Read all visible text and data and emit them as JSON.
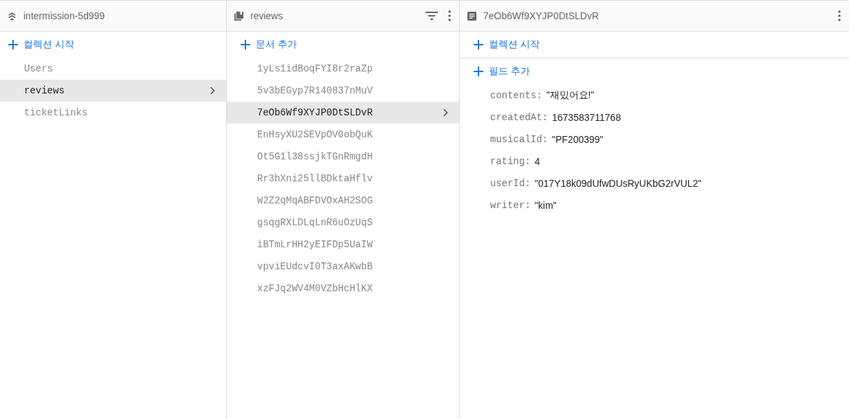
{
  "panels": [
    {
      "title": "intermission-5d999",
      "actions": [
        "컬렉션 시작"
      ],
      "items": [
        {
          "label": "Users",
          "selected": false
        },
        {
          "label": "reviews",
          "selected": true
        },
        {
          "label": "ticketLinks",
          "selected": false
        }
      ]
    },
    {
      "title": "reviews",
      "actions": [
        "문서 추가"
      ],
      "items": [
        {
          "label": "1yLs1idBoqFYI8r2raZp",
          "selected": false
        },
        {
          "label": "5v3bEGyp7R140837nMuV",
          "selected": false
        },
        {
          "label": "7eOb6Wf9XYJP0DtSLDvR",
          "selected": true
        },
        {
          "label": "EnHsyXU2SEVpOV0obQuK",
          "selected": false
        },
        {
          "label": "Ot5G1l38ssjkTGnRmgdH",
          "selected": false
        },
        {
          "label": "Rr3hXni25llBDktaHflv",
          "selected": false
        },
        {
          "label": "W2Z2qMqABFDVOxAH2SOG",
          "selected": false
        },
        {
          "label": "gsqgRXLDLqLnR6uOzUqS",
          "selected": false
        },
        {
          "label": "iBTmLrHH2yEIFDp5UaIW",
          "selected": false
        },
        {
          "label": "vpviEUdcvI0T3axAKwbB",
          "selected": false
        },
        {
          "label": "xzFJq2WV4M0VZbHcHlKX",
          "selected": false
        }
      ]
    },
    {
      "title": "7eOb6Wf9XYJP0DtSLDvR",
      "actions": [
        "컬렉션 시작",
        "필드 추가"
      ],
      "fields": [
        {
          "key": "contents:",
          "value": "\"재밌어요!\""
        },
        {
          "key": "createdAt:",
          "value": "1673583711768"
        },
        {
          "key": "musicalId:",
          "value": "\"PF200399\""
        },
        {
          "key": "rating:",
          "value": "4"
        },
        {
          "key": "userId:",
          "value": "\"017Y18k09dUfwDUsRyUKbG2rVUL2\""
        },
        {
          "key": "writer:",
          "value": "\"kim\""
        }
      ]
    }
  ]
}
